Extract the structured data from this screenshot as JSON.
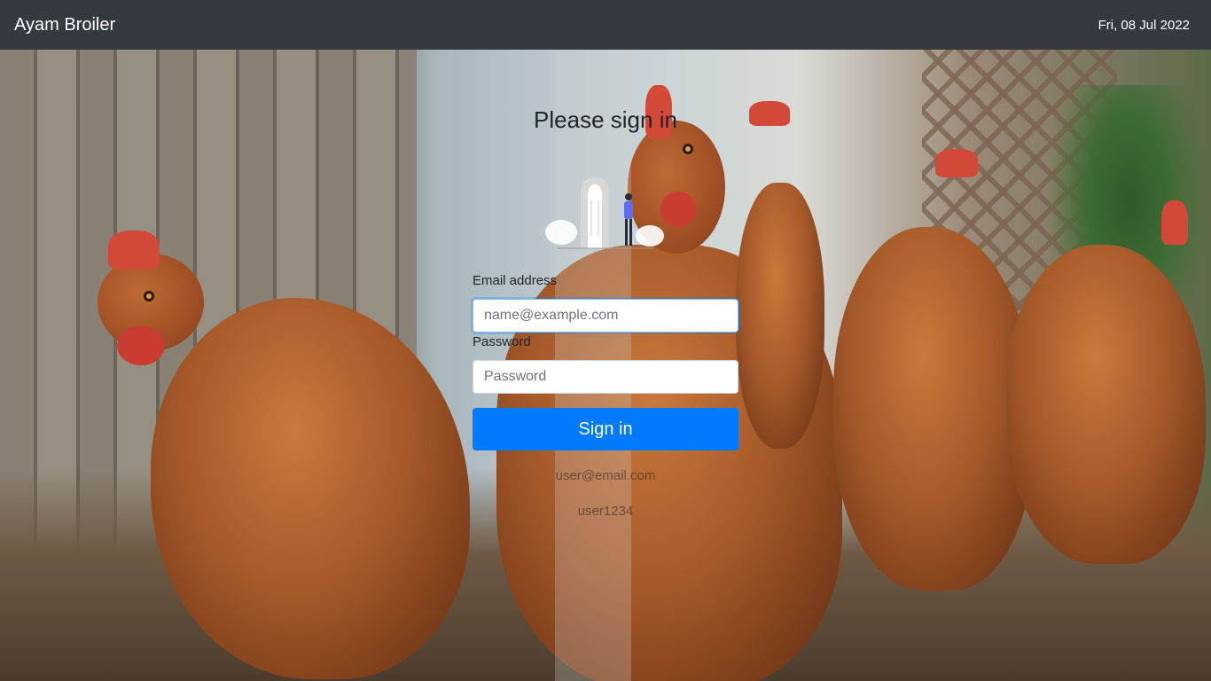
{
  "navbar": {
    "brand": "Ayam Broiler",
    "date": "Fri, 08 Jul 2022"
  },
  "signin": {
    "title": "Please sign in",
    "email_label": "Email address",
    "email_placeholder": "name@example.com",
    "password_label": "Password",
    "password_placeholder": "Password",
    "submit_label": "Sign in",
    "hint_email": "user@email.com",
    "hint_password": "user1234"
  },
  "colors": {
    "navbar_bg": "#343a40",
    "primary": "#007bff",
    "text": "#212529"
  },
  "icons": {
    "illustration": "door-person-illustration"
  }
}
